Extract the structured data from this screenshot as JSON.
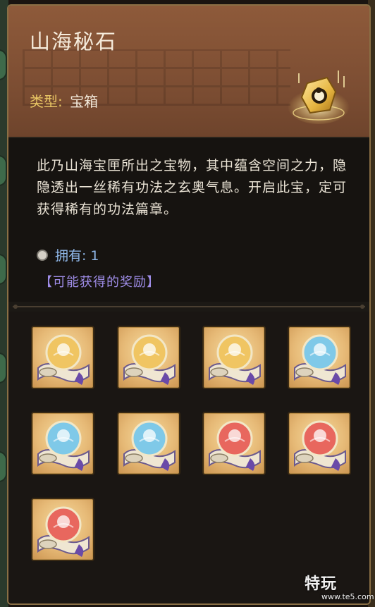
{
  "item": {
    "title": "山海秘石",
    "type_label": "类型:",
    "type_value": "宝箱",
    "icon": "golden-seal-icon"
  },
  "description": "此乃山海宝匣所出之宝物，其中蕴含空间之力，隐隐透出一丝稀有功法之玄奥气息。开启此宝，定可获得稀有的功法篇章。",
  "owned": {
    "label": "拥有:",
    "count": "1",
    "icon": "silver-coin-icon"
  },
  "rewards_label": "【可能获得的奖励】",
  "rewards": [
    {
      "icon": "scroll-orb-icon",
      "orb": "gold"
    },
    {
      "icon": "scroll-orb-icon",
      "orb": "gold"
    },
    {
      "icon": "scroll-orb-icon",
      "orb": "gold"
    },
    {
      "icon": "scroll-orb-icon",
      "orb": "blue"
    },
    {
      "icon": "scroll-orb-icon",
      "orb": "blue"
    },
    {
      "icon": "scroll-orb-icon",
      "orb": "blue"
    },
    {
      "icon": "scroll-orb-icon",
      "orb": "red"
    },
    {
      "icon": "scroll-orb-icon",
      "orb": "red"
    },
    {
      "icon": "scroll-orb-icon",
      "orb": "red"
    }
  ],
  "orb_colors": {
    "gold": "#f0c562",
    "blue": "#7fc9e8",
    "red": "#e8675e"
  },
  "watermark": {
    "text": "特玩",
    "url": "www.te5.com"
  }
}
